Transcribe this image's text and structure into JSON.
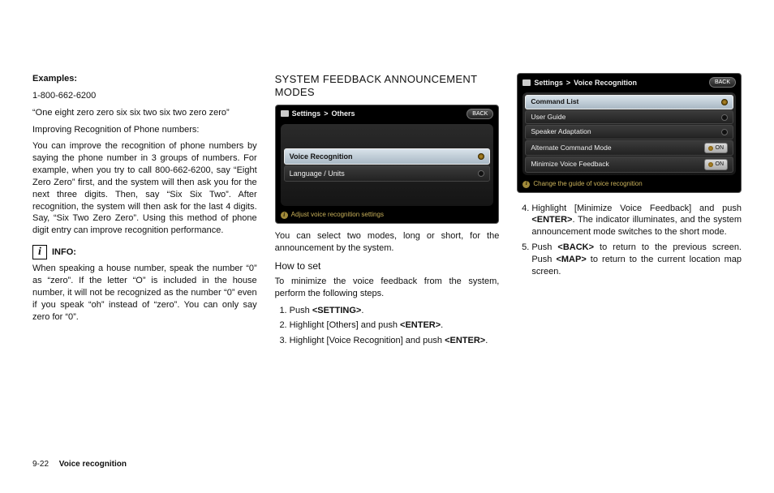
{
  "col1": {
    "examples_label": "Examples:",
    "phone_number": "1-800-662-6200",
    "phone_spoken": "“One eight zero zero six six two six two zero zero”",
    "improving_title": "Improving Recognition of Phone numbers:",
    "improving_body": "You can improve the recognition of phone numbers by saying the phone number in 3 groups of numbers. For example, when you try to call 800-662-6200, say “Eight Zero Zero” first, and the system will then ask you for the next three digits. Then, say “Six Six Two”. After recognition, the system will then ask for the last 4 digits. Say, “Six Two Zero Zero”. Using this method of phone digit entry can improve recognition performance.",
    "info_label": "INFO:",
    "info_body": "When speaking a house number, speak the number “0” as “zero”. If the letter “O” is included in the house number, it will not be recognized as the number “0” even if you speak “oh” instead of “zero”. You can only say zero for “0”."
  },
  "col2": {
    "heading": "SYSTEM FEEDBACK ANNOUNCEMENT MODES",
    "ss": {
      "breadcrumb_a": "Settings",
      "breadcrumb_b": "Others",
      "back": "BACK",
      "row1": "Voice Recognition",
      "row2": "Language / Units",
      "footer": "Adjust voice recognition settings"
    },
    "p1": "You can select two modes, long or short, for the announcement by the system.",
    "howto": "How to set",
    "p2": "To minimize the voice feedback from the system, perform the following steps.",
    "step1_pre": "Push ",
    "step1_b": "<SETTING>",
    "step1_post": ".",
    "step2_pre": "Highlight [Others] and push ",
    "step2_b": "<ENTER>",
    "step2_post": ".",
    "step3_pre": "Highlight [Voice Recognition] and push ",
    "step3_b": "<ENTER>",
    "step3_post": "."
  },
  "col3": {
    "ss": {
      "breadcrumb_a": "Settings",
      "breadcrumb_b": "Voice Recognition",
      "back": "BACK",
      "r1": "Command List",
      "r2": "User Guide",
      "r3": "Speaker Adaptation",
      "r4": "Alternate Command Mode",
      "r5": "Minimize Voice Feedback",
      "on": "ON",
      "footer": "Change the guide of voice recognition"
    },
    "step4_a": "Highlight [Minimize Voice Feedback] and push ",
    "step4_b": "<ENTER>",
    "step4_c": ". The indicator illuminates, and the system announcement mode switches to the short mode.",
    "step5_a": "Push ",
    "step5_b": "<BACK>",
    "step5_c": " to return to the previous screen. Push ",
    "step5_d": "<MAP>",
    "step5_e": " to return to the current location map screen."
  },
  "footer": {
    "page": "9-22",
    "section": "Voice recognition"
  }
}
